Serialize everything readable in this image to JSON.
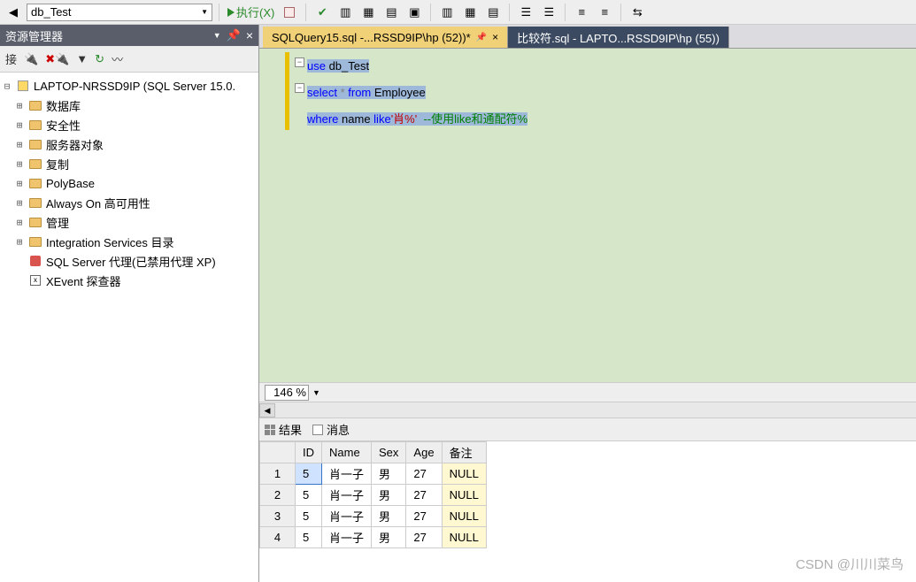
{
  "toolbar": {
    "db_combo": "db_Test",
    "execute_label": "执行(X)"
  },
  "sidebar": {
    "title": "资源管理器",
    "connect_label": "接",
    "server": "LAPTOP-NRSSD9IP (SQL Server 15.0.",
    "nodes": [
      {
        "label": "数据库",
        "icon": "folder"
      },
      {
        "label": "安全性",
        "icon": "folder"
      },
      {
        "label": "服务器对象",
        "icon": "folder"
      },
      {
        "label": "复制",
        "icon": "folder"
      },
      {
        "label": "PolyBase",
        "icon": "folder"
      },
      {
        "label": "Always On 高可用性",
        "icon": "folder"
      },
      {
        "label": "管理",
        "icon": "folder"
      },
      {
        "label": "Integration Services 目录",
        "icon": "folder"
      },
      {
        "label": "SQL Server 代理(已禁用代理 XP)",
        "icon": "agent"
      },
      {
        "label": "XEvent 探查器",
        "icon": "xe"
      }
    ]
  },
  "tabs": {
    "active": "SQLQuery15.sql -...RSSD9IP\\hp (52))*",
    "inactive": "比较符.sql - LAPTO...RSSD9IP\\hp (55))"
  },
  "code": {
    "l1": {
      "kw": "use",
      "id": " db_Test"
    },
    "l2": {
      "kw": "select",
      "op": " * ",
      "kw2": "from",
      "id": " Employee"
    },
    "l3": {
      "kw": "where",
      "id": " name ",
      "kw2": "like",
      "str": "'肖%'",
      "sp": "  ",
      "cmt": "--使用like和通配符%"
    }
  },
  "zoom": {
    "value": "146 %"
  },
  "result_tabs": {
    "results": "结果",
    "messages": "消息"
  },
  "grid": {
    "columns": [
      "ID",
      "Name",
      "Sex",
      "Age",
      "备注"
    ],
    "rows": [
      {
        "n": "1",
        "ID": "5",
        "Name": "肖一子",
        "Sex": "男",
        "Age": "27",
        "备注": "NULL"
      },
      {
        "n": "2",
        "ID": "5",
        "Name": "肖一子",
        "Sex": "男",
        "Age": "27",
        "备注": "NULL"
      },
      {
        "n": "3",
        "ID": "5",
        "Name": "肖一子",
        "Sex": "男",
        "Age": "27",
        "备注": "NULL"
      },
      {
        "n": "4",
        "ID": "5",
        "Name": "肖一子",
        "Sex": "男",
        "Age": "27",
        "备注": "NULL"
      }
    ]
  },
  "watermark": "CSDN @川川菜鸟"
}
